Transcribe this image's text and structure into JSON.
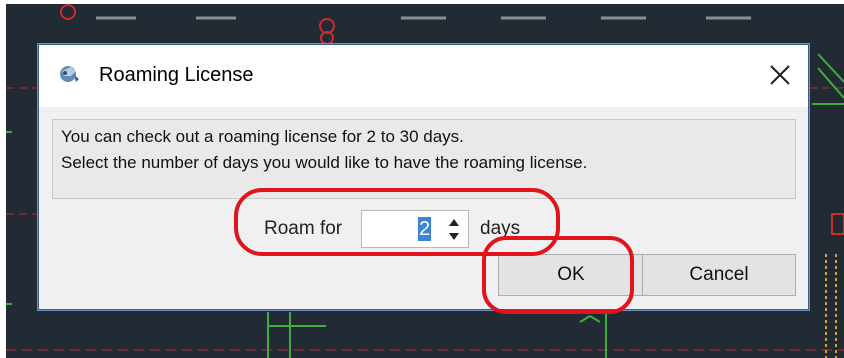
{
  "dialog": {
    "title": "Roaming License",
    "close_symbol": "✕",
    "message_line1": "You can check out a roaming license for 2 to 30 days.",
    "message_line2": "Select the number of days you would like to have the roaming license.",
    "roam_label": "Roam for",
    "days_value": "2",
    "days_label": "days",
    "ok_label": "OK",
    "cancel_label": "Cancel"
  },
  "icons": {
    "app": "roaming-app-icon",
    "close": "close-icon",
    "spin_up": "spin-up-arrow-icon",
    "spin_down": "spin-down-arrow-icon"
  },
  "colors": {
    "annotation": "#e0141c",
    "selection": "#3d83d8",
    "cad_background": "#222a33"
  }
}
